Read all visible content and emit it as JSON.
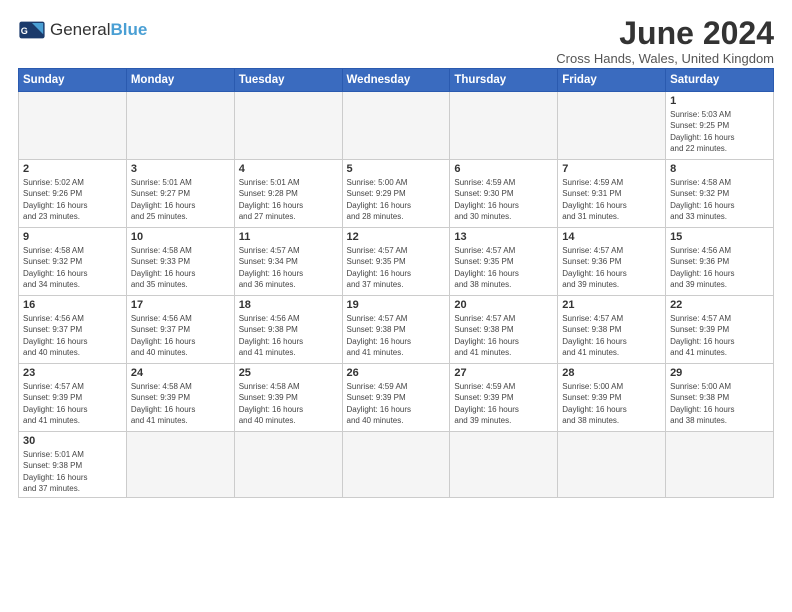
{
  "logo": {
    "text_general": "General",
    "text_blue": "Blue"
  },
  "title": "June 2024",
  "subtitle": "Cross Hands, Wales, United Kingdom",
  "days_of_week": [
    "Sunday",
    "Monday",
    "Tuesday",
    "Wednesday",
    "Thursday",
    "Friday",
    "Saturday"
  ],
  "weeks": [
    [
      {
        "day": "",
        "info": ""
      },
      {
        "day": "",
        "info": ""
      },
      {
        "day": "",
        "info": ""
      },
      {
        "day": "",
        "info": ""
      },
      {
        "day": "",
        "info": ""
      },
      {
        "day": "",
        "info": ""
      },
      {
        "day": "1",
        "info": "Sunrise: 5:03 AM\nSunset: 9:25 PM\nDaylight: 16 hours\nand 22 minutes."
      }
    ],
    [
      {
        "day": "2",
        "info": "Sunrise: 5:02 AM\nSunset: 9:26 PM\nDaylight: 16 hours\nand 23 minutes."
      },
      {
        "day": "3",
        "info": "Sunrise: 5:01 AM\nSunset: 9:27 PM\nDaylight: 16 hours\nand 25 minutes."
      },
      {
        "day": "4",
        "info": "Sunrise: 5:01 AM\nSunset: 9:28 PM\nDaylight: 16 hours\nand 27 minutes."
      },
      {
        "day": "5",
        "info": "Sunrise: 5:00 AM\nSunset: 9:29 PM\nDaylight: 16 hours\nand 28 minutes."
      },
      {
        "day": "6",
        "info": "Sunrise: 4:59 AM\nSunset: 9:30 PM\nDaylight: 16 hours\nand 30 minutes."
      },
      {
        "day": "7",
        "info": "Sunrise: 4:59 AM\nSunset: 9:31 PM\nDaylight: 16 hours\nand 31 minutes."
      },
      {
        "day": "8",
        "info": "Sunrise: 4:58 AM\nSunset: 9:32 PM\nDaylight: 16 hours\nand 33 minutes."
      }
    ],
    [
      {
        "day": "9",
        "info": "Sunrise: 4:58 AM\nSunset: 9:32 PM\nDaylight: 16 hours\nand 34 minutes."
      },
      {
        "day": "10",
        "info": "Sunrise: 4:58 AM\nSunset: 9:33 PM\nDaylight: 16 hours\nand 35 minutes."
      },
      {
        "day": "11",
        "info": "Sunrise: 4:57 AM\nSunset: 9:34 PM\nDaylight: 16 hours\nand 36 minutes."
      },
      {
        "day": "12",
        "info": "Sunrise: 4:57 AM\nSunset: 9:35 PM\nDaylight: 16 hours\nand 37 minutes."
      },
      {
        "day": "13",
        "info": "Sunrise: 4:57 AM\nSunset: 9:35 PM\nDaylight: 16 hours\nand 38 minutes."
      },
      {
        "day": "14",
        "info": "Sunrise: 4:57 AM\nSunset: 9:36 PM\nDaylight: 16 hours\nand 39 minutes."
      },
      {
        "day": "15",
        "info": "Sunrise: 4:56 AM\nSunset: 9:36 PM\nDaylight: 16 hours\nand 39 minutes."
      }
    ],
    [
      {
        "day": "16",
        "info": "Sunrise: 4:56 AM\nSunset: 9:37 PM\nDaylight: 16 hours\nand 40 minutes."
      },
      {
        "day": "17",
        "info": "Sunrise: 4:56 AM\nSunset: 9:37 PM\nDaylight: 16 hours\nand 40 minutes."
      },
      {
        "day": "18",
        "info": "Sunrise: 4:56 AM\nSunset: 9:38 PM\nDaylight: 16 hours\nand 41 minutes."
      },
      {
        "day": "19",
        "info": "Sunrise: 4:57 AM\nSunset: 9:38 PM\nDaylight: 16 hours\nand 41 minutes."
      },
      {
        "day": "20",
        "info": "Sunrise: 4:57 AM\nSunset: 9:38 PM\nDaylight: 16 hours\nand 41 minutes."
      },
      {
        "day": "21",
        "info": "Sunrise: 4:57 AM\nSunset: 9:38 PM\nDaylight: 16 hours\nand 41 minutes."
      },
      {
        "day": "22",
        "info": "Sunrise: 4:57 AM\nSunset: 9:39 PM\nDaylight: 16 hours\nand 41 minutes."
      }
    ],
    [
      {
        "day": "23",
        "info": "Sunrise: 4:57 AM\nSunset: 9:39 PM\nDaylight: 16 hours\nand 41 minutes."
      },
      {
        "day": "24",
        "info": "Sunrise: 4:58 AM\nSunset: 9:39 PM\nDaylight: 16 hours\nand 41 minutes."
      },
      {
        "day": "25",
        "info": "Sunrise: 4:58 AM\nSunset: 9:39 PM\nDaylight: 16 hours\nand 40 minutes."
      },
      {
        "day": "26",
        "info": "Sunrise: 4:59 AM\nSunset: 9:39 PM\nDaylight: 16 hours\nand 40 minutes."
      },
      {
        "day": "27",
        "info": "Sunrise: 4:59 AM\nSunset: 9:39 PM\nDaylight: 16 hours\nand 39 minutes."
      },
      {
        "day": "28",
        "info": "Sunrise: 5:00 AM\nSunset: 9:39 PM\nDaylight: 16 hours\nand 38 minutes."
      },
      {
        "day": "29",
        "info": "Sunrise: 5:00 AM\nSunset: 9:38 PM\nDaylight: 16 hours\nand 38 minutes."
      }
    ],
    [
      {
        "day": "30",
        "info": "Sunrise: 5:01 AM\nSunset: 9:38 PM\nDaylight: 16 hours\nand 37 minutes."
      },
      {
        "day": "",
        "info": ""
      },
      {
        "day": "",
        "info": ""
      },
      {
        "day": "",
        "info": ""
      },
      {
        "day": "",
        "info": ""
      },
      {
        "day": "",
        "info": ""
      },
      {
        "day": "",
        "info": ""
      }
    ]
  ]
}
